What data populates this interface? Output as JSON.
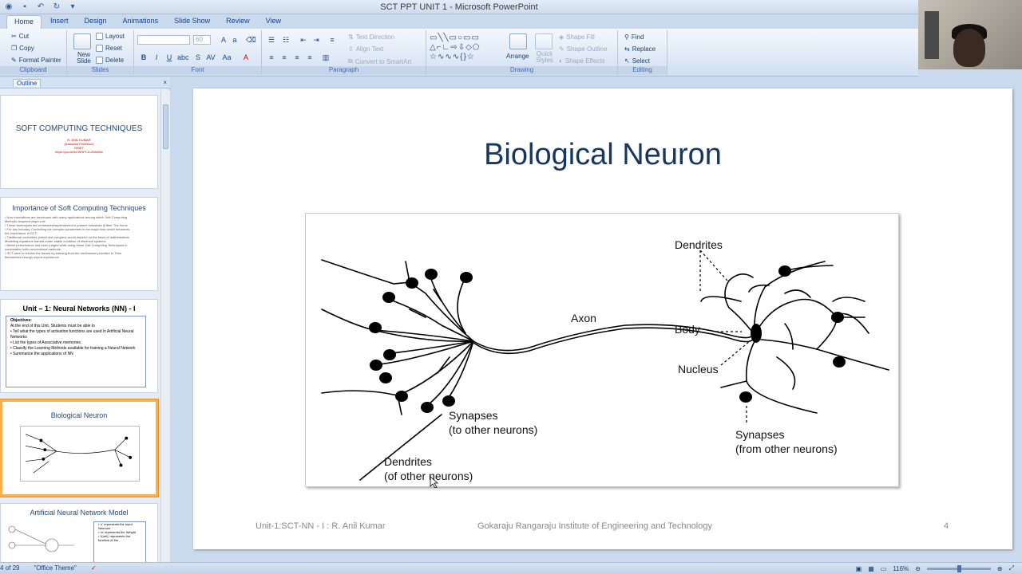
{
  "window": {
    "title": "SCT PPT UNIT 1 - Microsoft PowerPoint"
  },
  "ribbon_tabs": [
    "Home",
    "Insert",
    "Design",
    "Animations",
    "Slide Show",
    "Review",
    "View"
  ],
  "ribbon": {
    "clipboard": {
      "label": "Clipboard",
      "cut": "Cut",
      "copy": "Copy",
      "format_painter": "Format Painter"
    },
    "slides": {
      "label": "Slides",
      "new_slide": "New Slide",
      "layout": "Layout",
      "reset": "Reset",
      "delete": "Delete"
    },
    "font": {
      "label": "Font",
      "size_placeholder": "60"
    },
    "paragraph": {
      "label": "Paragraph",
      "text_direction": "Text Direction",
      "align_text": "Align Text",
      "convert_smartart": "Convert to SmartArt"
    },
    "drawing": {
      "label": "Drawing",
      "arrange": "Arrange",
      "quick_styles": "Quick Styles",
      "shape_fill": "Shape Fill",
      "shape_outline": "Shape Outline",
      "shape_effects": "Shape Effects"
    },
    "editing": {
      "label": "Editing",
      "find": "Find",
      "replace": "Replace",
      "select": "Select"
    }
  },
  "left_pane": {
    "tab_outline": "Outline",
    "close": "×",
    "slides": [
      {
        "title": "SOFT COMPUTING TECHNIQUES",
        "lines": [
          "R. ANIL KUMAR",
          "(Assistant Professor)",
          "GRIET",
          "https://youtu.be/WHPCXuSWeBw"
        ]
      },
      {
        "title": "Importance of Soft Computing Techniques",
        "lines": [
          "• Now innovations are developed with many applications among which Soft Computing",
          "  Methods acquired major role.",
          "• These techniques are embedded/implemented in present industries (Either The home",
          "• For any industry, Controlling the complex parameters is the major task which enhances",
          "  the importance of SCT.",
          "• Traditional controllers (which are complex) would depend on the basis of mathematical",
          "  Modelling equations framed under stable condition of electrical systems.",
          "• Better performance has been judged while using these Soft Computing Techniques in",
          "  combination with conventional methods.",
          "• SCT area to resolve the issues by learning from the mechanism provided to Their",
          "  themselves through expert experience."
        ]
      },
      {
        "title": "Unit – 1: Neural Networks (NN) - I",
        "lines": [
          "Objectives:",
          "At the end of this Unit, Students must be able to",
          "• Tell what the types of activation functions are used in Artificial Neural Networks",
          "• List the types of Associative memories.",
          "• Classify the Learning Methods available for training a Neural Network",
          "• Summarize the applications of NN"
        ]
      },
      {
        "title": "Biological Neuron",
        "lines": []
      },
      {
        "title": "Artificial Neural Network Model",
        "lines": [
          "• 'x' represents the Input Neurons",
          "• 'w' represents the Weight",
          "• 'f(net)' represents the function of the"
        ]
      }
    ]
  },
  "slide": {
    "title": "Biological Neuron",
    "figure_labels": {
      "dendrites_top": "Dendrites",
      "axon": "Axon",
      "body": "Body",
      "nucleus": "Nucleus",
      "synapses_to_1": "Synapses",
      "synapses_to_2": "(to other neurons)",
      "synapses_from_1": "Synapses",
      "synapses_from_2": "(from other neurons)",
      "dendrites_bottom_1": "Dendrites",
      "dendrites_bottom_2": "(of other neurons)"
    },
    "footer_left": "Unit-1:SCT-NN - I : R. Anil Kumar",
    "footer_center": "Gokaraju Rangaraju Institute of Engineering and Technology",
    "footer_right": "4"
  },
  "status": {
    "slide_count": "4 of 29",
    "theme": "\"Office Theme\"",
    "zoom": "116%"
  }
}
